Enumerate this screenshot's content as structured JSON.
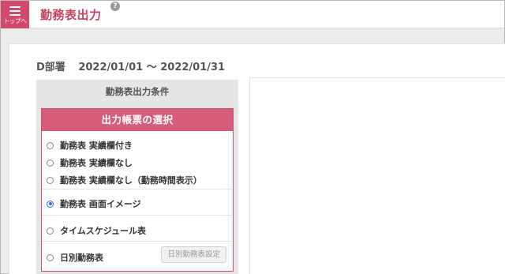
{
  "header": {
    "menu_label": "トップへ",
    "title": "勤務表出力",
    "help_symbol": "?"
  },
  "summary": {
    "department": "D部署",
    "period": "2022/01/01 〜 2022/01/31"
  },
  "conditions": {
    "title": "勤務表出力条件",
    "select_title": "出力帳票の選択",
    "options": [
      {
        "label": "勤務表 実績欄付き",
        "checked": false
      },
      {
        "label": "勤務表 実績欄なし",
        "checked": false
      },
      {
        "label": "勤務表 実績欄なし（勤務時間表示）",
        "checked": false
      },
      {
        "label": "勤務表 画面イメージ",
        "checked": true
      },
      {
        "label": "タイムスケジュール表",
        "checked": false
      },
      {
        "label": "日別勤務表",
        "checked": false
      }
    ],
    "daily_settings_button": "日別勤務表設定"
  },
  "colors": {
    "accent": "#d24a6b",
    "select_header": "#d55d7a",
    "radio_checked": "#2a6fdb"
  }
}
